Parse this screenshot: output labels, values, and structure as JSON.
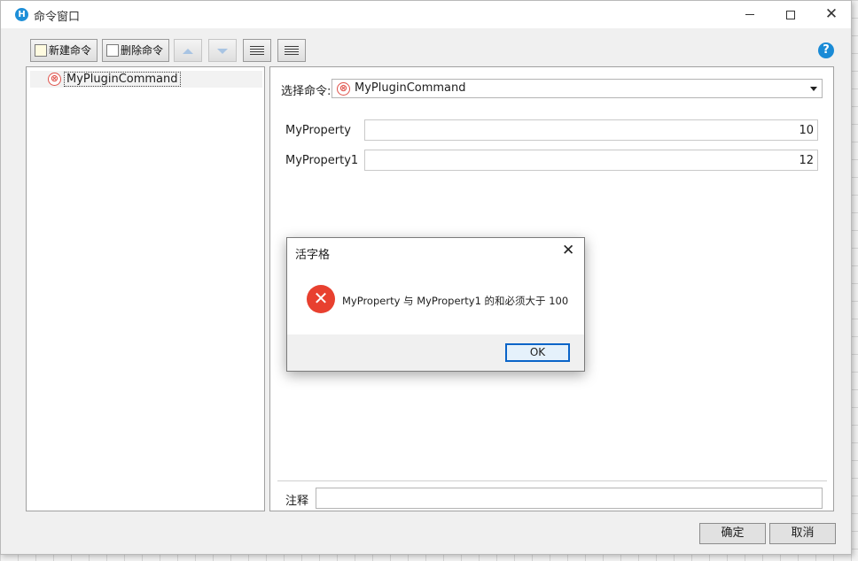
{
  "window": {
    "title": "命令窗口",
    "app_icon": "H",
    "minimize": "minimize-icon",
    "maximize": "maximize-icon",
    "close": "✕"
  },
  "toolbar": {
    "new_label": "新建命令",
    "delete_label": "删除命令",
    "move_up": "move-up-icon",
    "move_down": "move-down-icon",
    "indent": "indent-icon",
    "outdent": "outdent-icon"
  },
  "help": "?",
  "tree": {
    "items": [
      {
        "label": "MyPluginCommand",
        "status": "error-icon",
        "status_glyph": "⊗"
      }
    ]
  },
  "editor": {
    "select_label": "选择命令:",
    "selected_command": "MyPluginCommand",
    "status_glyph": "⊗",
    "properties": [
      {
        "label": "MyProperty",
        "value": "10"
      },
      {
        "label": "MyProperty1",
        "value": "12"
      }
    ],
    "note_label": "注释",
    "note_value": ""
  },
  "footer": {
    "ok_label": "确定",
    "cancel_label": "取消"
  },
  "dialog": {
    "title": "活字格",
    "close": "✕",
    "icon_glyph": "✕",
    "message": "MyProperty 与 MyProperty1 的和必须大于 100",
    "ok_label": "OK"
  },
  "colors": {
    "accent": "#0a64c8",
    "error": "#e8402f",
    "help": "#1a8bd6"
  }
}
